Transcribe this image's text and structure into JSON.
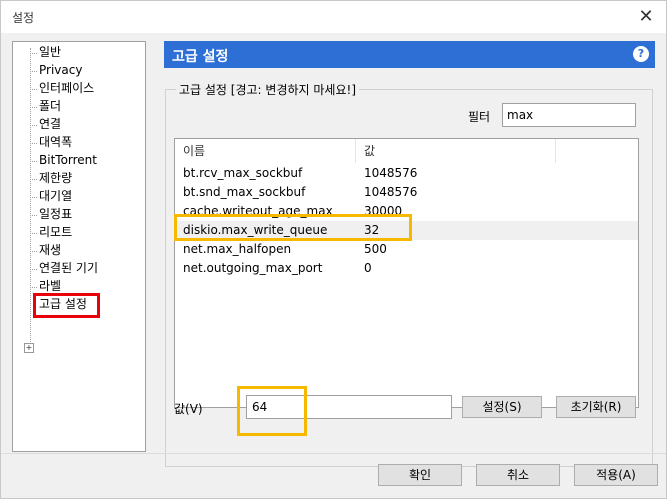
{
  "window": {
    "title": "설정"
  },
  "sidebar": {
    "items": [
      {
        "label": "일반"
      },
      {
        "label": "Privacy"
      },
      {
        "label": "인터페이스"
      },
      {
        "label": "폴더"
      },
      {
        "label": "연결"
      },
      {
        "label": "대역폭"
      },
      {
        "label": "BitTorrent"
      },
      {
        "label": "제한량"
      },
      {
        "label": "대기열"
      },
      {
        "label": "일정표"
      },
      {
        "label": "리모트"
      },
      {
        "label": "재생"
      },
      {
        "label": "연결된 기기"
      },
      {
        "label": "라벨"
      },
      {
        "label": "고급 설정"
      }
    ]
  },
  "panel": {
    "title": "고급 설정",
    "group_label": "고급 설정 [경고: 변경하지 마세요!]",
    "filter_label": "필터",
    "filter_value": "max",
    "columns": [
      "이름",
      "값"
    ],
    "rows": [
      {
        "name": "bt.rcv_max_sockbuf",
        "value": "1048576"
      },
      {
        "name": "bt.snd_max_sockbuf",
        "value": "1048576"
      },
      {
        "name": "cache.writeout_age_max",
        "value": "30000"
      },
      {
        "name": "diskio.max_write_queue",
        "value": "32"
      },
      {
        "name": "net.max_halfopen",
        "value": "500"
      },
      {
        "name": "net.outgoing_max_port",
        "value": "0"
      }
    ],
    "value_label": "값(V)",
    "value_input": "64",
    "set_button": "설정(S)",
    "reset_button": "초기화(R)"
  },
  "footer": {
    "ok_button": "확인",
    "cancel_button": "취소",
    "apply_button": "적용(A)"
  },
  "colors": {
    "header_bg": "#2d6fd4",
    "highlight_red": "#e8000b",
    "highlight_yellow": "#f7b800"
  }
}
